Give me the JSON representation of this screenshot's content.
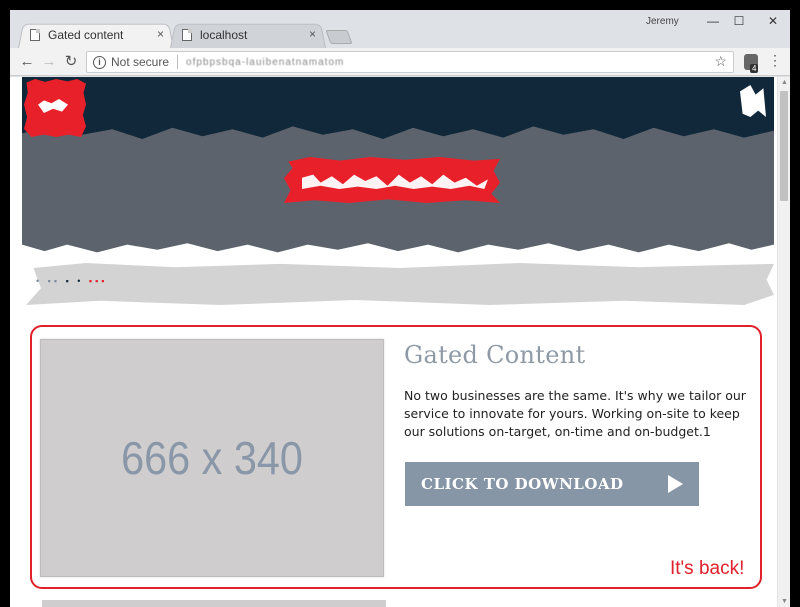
{
  "browser": {
    "tabs": [
      {
        "title": "Gated content",
        "close": "×"
      },
      {
        "title": "localhost",
        "close": "×"
      }
    ],
    "profile": "Jeremy",
    "window_controls": {
      "minimize": "—",
      "maximize": "☐",
      "close": "✕"
    },
    "nav": {
      "back": "←",
      "forward": "→",
      "reload": "↻"
    },
    "security_label": "Not secure",
    "url": "ofpbpsbqa-lauibenatnamatom",
    "bookmark": "☆",
    "extension_badge": "4",
    "menu": "⋮"
  },
  "scrollbar": {
    "up": "▲",
    "down": "▼"
  },
  "breadcrumb": {
    "glyphs_a": "• ▪▪",
    "glyphs_b": "▪ •",
    "glyphs_c": "▪▪▪"
  },
  "gated": {
    "placeholder": "666 x 340",
    "title": "Gated Content",
    "body": "No two businesses are the same. It's why we tailor our service to innovate for yours. Working on-site to keep our solutions on-target, on-time and on-budget.1",
    "button_label": "CLICK TO DOWNLOAD",
    "annotation": "It's back!"
  },
  "colors": {
    "header": "#10283a",
    "hero": "#5d636d",
    "brand_red": "#e8202a",
    "button": "#8696a7",
    "title_gray": "#8e9aa6"
  }
}
